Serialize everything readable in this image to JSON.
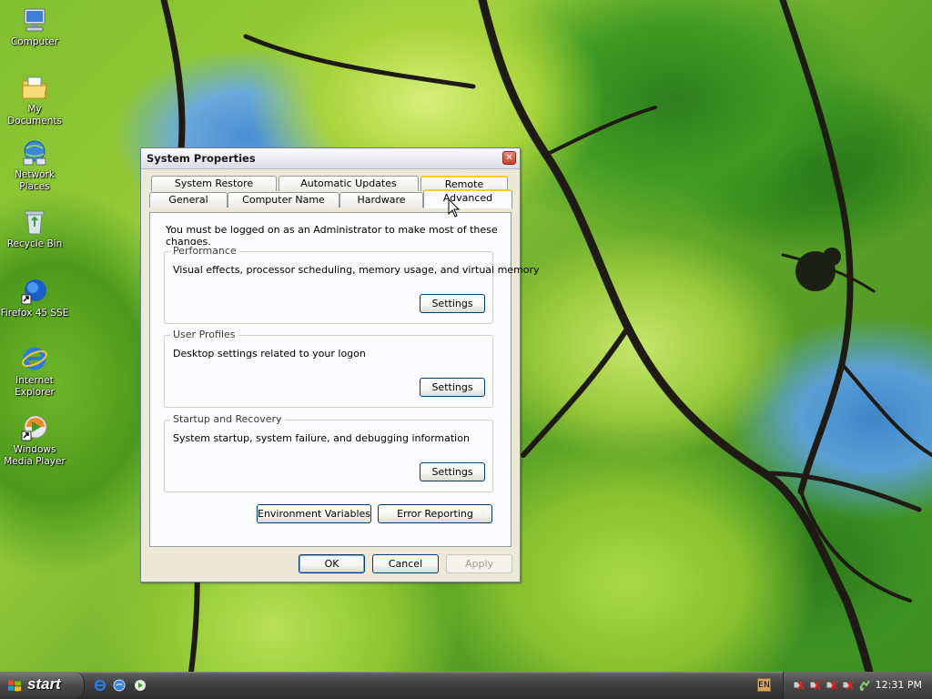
{
  "desktop_icons": [
    {
      "label": "Computer",
      "icon": "computer-icon"
    },
    {
      "label": "My Documents",
      "icon": "my-documents-icon"
    },
    {
      "label": "Network Places",
      "icon": "network-places-icon"
    },
    {
      "label": "Recycle Bin",
      "icon": "recycle-bin-icon"
    },
    {
      "label": "Firefox 45 SSE",
      "icon": "firefox-icon"
    },
    {
      "label": "Internet Explorer",
      "icon": "internet-explorer-icon"
    },
    {
      "label": "Windows Media Player",
      "icon": "media-player-icon"
    }
  ],
  "window": {
    "title": "System Properties",
    "tabs_top": [
      "System Restore",
      "Automatic Updates",
      "Remote"
    ],
    "tabs_bottom": [
      "General",
      "Computer Name",
      "Hardware",
      "Advanced"
    ],
    "active_tab": "Advanced",
    "intro": "You must be logged on as an Administrator to make most of these changes.",
    "groups": {
      "performance": {
        "title": "Performance",
        "description": "Visual effects, processor scheduling, memory usage, and virtual memory",
        "button": "Settings"
      },
      "user_profiles": {
        "title": "User Profiles",
        "description": "Desktop settings related to your logon",
        "button": "Settings"
      },
      "startup_recovery": {
        "title": "Startup and Recovery",
        "description": "System startup, system failure, and debugging information",
        "button": "Settings"
      }
    },
    "env_vars_button": "Environment Variables",
    "error_reporting_button": "Error Reporting",
    "ok_button": "OK",
    "cancel_button": "Cancel",
    "apply_button": "Apply"
  },
  "taskbar": {
    "start_label": "start",
    "language": "EN",
    "clock": "12:31 PM"
  },
  "colors": {
    "tab_highlight": "#ffc83c",
    "button_border": "#003c74",
    "dialog_background": "#ece9d8"
  }
}
